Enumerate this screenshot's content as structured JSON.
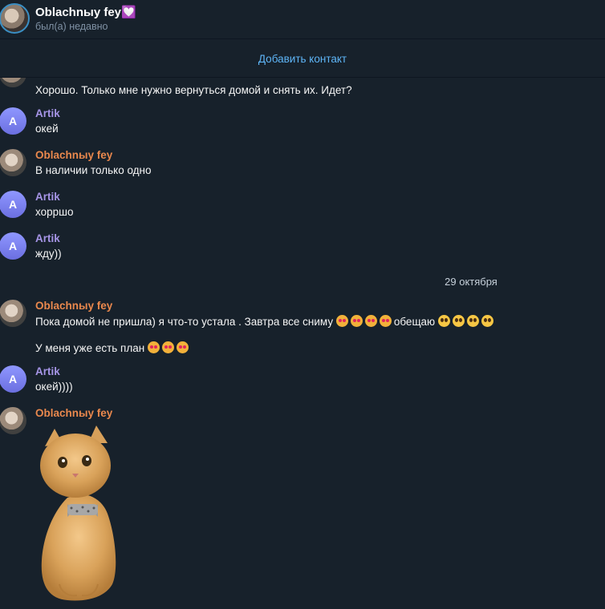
{
  "header": {
    "title": "Oblachnыy fey💟",
    "status": "был(а) недавно"
  },
  "add_contact_label": "Добавить контакт",
  "messages": [
    {
      "text": "Хорошо. Только мне нужно вернуться домой и снять их. Идет?"
    },
    {
      "sender": "Artik",
      "avatar_letter": "A",
      "text": "окей"
    },
    {
      "sender": "Oblachnыy fey",
      "text": "В наличии только одно"
    },
    {
      "sender": "Artik",
      "avatar_letter": "A",
      "text": "хорршо"
    },
    {
      "sender": "Artik",
      "avatar_letter": "A",
      "text": "жду))"
    },
    {
      "date": "29 октября"
    },
    {
      "sender": "Oblachnыy fey",
      "text_before": "Пока домой не пришла) я что-то устала . Завтра все сниму",
      "text_after": "обещаю"
    },
    {
      "text": "У меня уже есть план"
    },
    {
      "sender": "Artik",
      "avatar_letter": "A",
      "text": "окей))))"
    },
    {
      "sender": "Oblachnыy fey"
    }
  ],
  "colors": {
    "background": "#17212b",
    "accent": "#5eb5f7",
    "artik_name": "#a695e7",
    "oblach_name": "#e9884d"
  }
}
